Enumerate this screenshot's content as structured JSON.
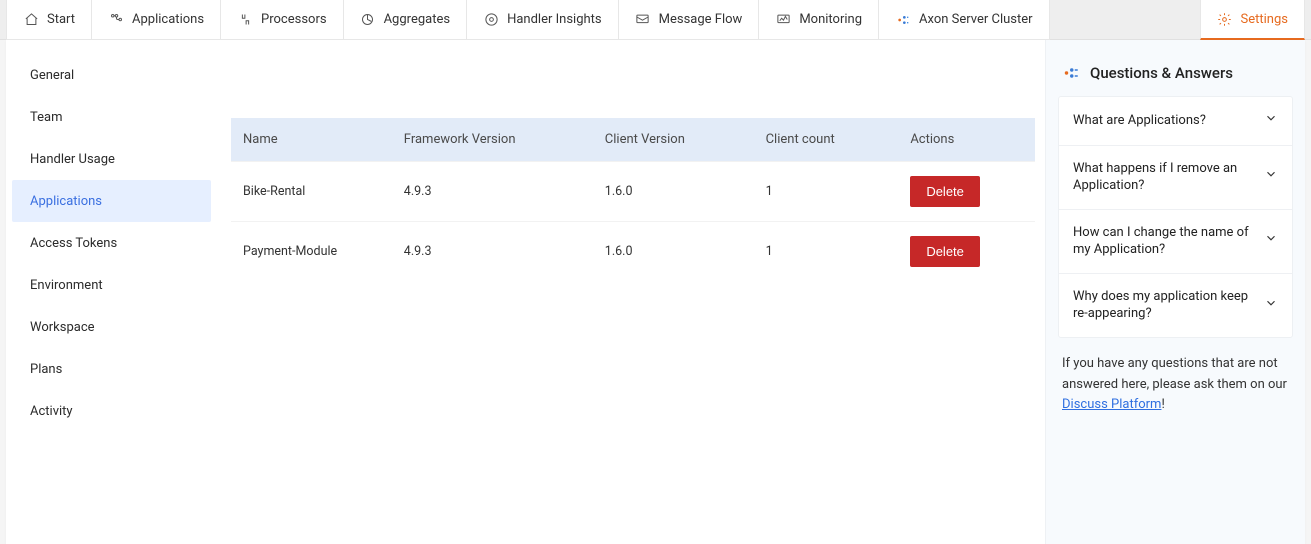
{
  "topnav": {
    "tabs": [
      {
        "label": "Start",
        "icon": "home"
      },
      {
        "label": "Applications",
        "icon": "apps"
      },
      {
        "label": "Processors",
        "icon": "processors"
      },
      {
        "label": "Aggregates",
        "icon": "aggregates"
      },
      {
        "label": "Handler Insights",
        "icon": "insights"
      },
      {
        "label": "Message Flow",
        "icon": "flow"
      },
      {
        "label": "Monitoring",
        "icon": "monitoring"
      },
      {
        "label": "Axon Server Cluster",
        "icon": "axon"
      }
    ],
    "settings_label": "Settings"
  },
  "sidebar": {
    "items": [
      {
        "label": "General"
      },
      {
        "label": "Team"
      },
      {
        "label": "Handler Usage"
      },
      {
        "label": "Applications",
        "active": true
      },
      {
        "label": "Access Tokens"
      },
      {
        "label": "Environment"
      },
      {
        "label": "Workspace"
      },
      {
        "label": "Plans"
      },
      {
        "label": "Activity"
      }
    ]
  },
  "table": {
    "headers": {
      "name": "Name",
      "framework_version": "Framework Version",
      "client_version": "Client Version",
      "client_count": "Client count",
      "actions": "Actions"
    },
    "rows": [
      {
        "name": "Bike-Rental",
        "framework_version": "4.9.3",
        "client_version": "1.6.0",
        "client_count": "1"
      },
      {
        "name": "Payment-Module",
        "framework_version": "4.9.3",
        "client_version": "1.6.0",
        "client_count": "1"
      }
    ],
    "delete_label": "Delete"
  },
  "qa": {
    "title": "Questions & Answers",
    "items": [
      "What are Applications?",
      "What happens if I remove an Application?",
      "How can I change the name of my Application?",
      "Why does my application keep re-appearing?"
    ],
    "note_prefix": "If you have any questions that are not answered here, please ask them on our ",
    "note_link": "Discuss Platform",
    "note_suffix": "!"
  },
  "colors": {
    "accent": "#e66a1f",
    "link": "#2f6fe0",
    "danger": "#c62828"
  }
}
